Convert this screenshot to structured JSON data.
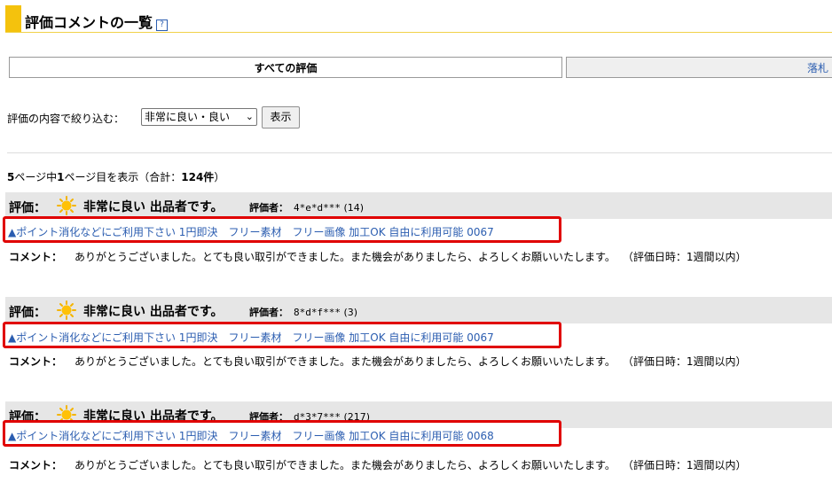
{
  "header": {
    "title": "評価コメントの一覧",
    "help_icon": "?"
  },
  "tabs": [
    {
      "label": "すべての評価"
    },
    {
      "label": "落札"
    }
  ],
  "filter": {
    "label": "評価の内容で絞り込む：",
    "selected": "非常に良い・良い",
    "button": "表示"
  },
  "page_info": {
    "total_pages": "5",
    "prefix": "ページ中",
    "current_page": "1",
    "suffix": "ページ目を表示（合計：",
    "total_count": "124件",
    "close": "）"
  },
  "reviews": [
    {
      "rating_label": "評価：",
      "rating": "非常に良い 出品者です。",
      "rater_label": "評価者：",
      "rater_id": "4*e*d***",
      "rater_score": "(14)",
      "item": "▲ポイント消化などにご利用下さい 1円即決　フリー素材　フリー画像 加工OK 自由に利用可能 0067",
      "comment_label": "コメント：",
      "comment": "ありがとうございました。とても良い取引ができました。また機会がありましたら、よろしくお願いいたします。",
      "date": "（評価日時：1週間以内）"
    },
    {
      "rating_label": "評価：",
      "rating": "非常に良い 出品者です。",
      "rater_label": "評価者：",
      "rater_id": "8*d*f***",
      "rater_score": "(3)",
      "item": "▲ポイント消化などにご利用下さい 1円即決　フリー素材　フリー画像 加工OK 自由に利用可能 0067",
      "comment_label": "コメント：",
      "comment": "ありがとうございました。とても良い取引ができました。また機会がありましたら、よろしくお願いいたします。",
      "date": "（評価日時：1週間以内）"
    },
    {
      "rating_label": "評価：",
      "rating": "非常に良い 出品者です。",
      "rater_label": "評価者：",
      "rater_id": "d*3*7***",
      "rater_score": "(217)",
      "item": "▲ポイント消化などにご利用下さい 1円即決　フリー素材　フリー画像 加工OK 自由に利用可能 0068",
      "comment_label": "コメント：",
      "comment": "ありがとうございました。とても良い取引ができました。また機会がありましたら、よろしくお願いいたします。",
      "date": "（評価日時：1週間以内）"
    }
  ],
  "colors": {
    "accent": "#f4c20d",
    "link": "#2b5db0",
    "highlight_box": "#e00000",
    "header_bg": "#e6e6e6"
  }
}
